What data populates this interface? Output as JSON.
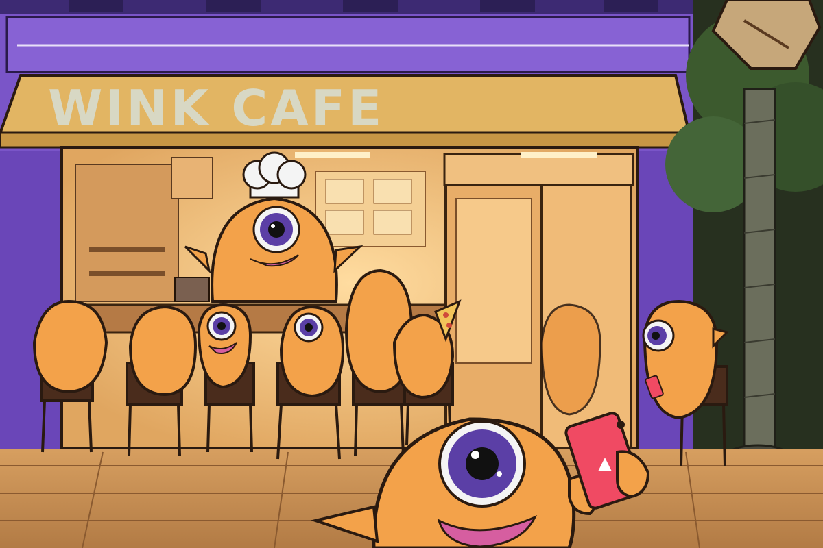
{
  "sign": {
    "text": "WINK CAFE"
  },
  "colors": {
    "building_purple": "#7a55c8",
    "building_dark": "#4c3192",
    "awning": "#e2b563",
    "sign_text": "#d8d8c4",
    "interior_glow": "#f2c27e",
    "creature_orange": "#f3a24a",
    "creature_outline": "#2a1a10",
    "eye_purple": "#5b3fa6",
    "mouth_pink": "#d65ea0",
    "phone_red": "#f04a63",
    "sidewalk": "#c9945a",
    "tree_green": "#3c5a2e"
  },
  "icons": [
    "chef-hat",
    "smartphone",
    "pizza-slice",
    "street-sign",
    "palm-tree"
  ]
}
